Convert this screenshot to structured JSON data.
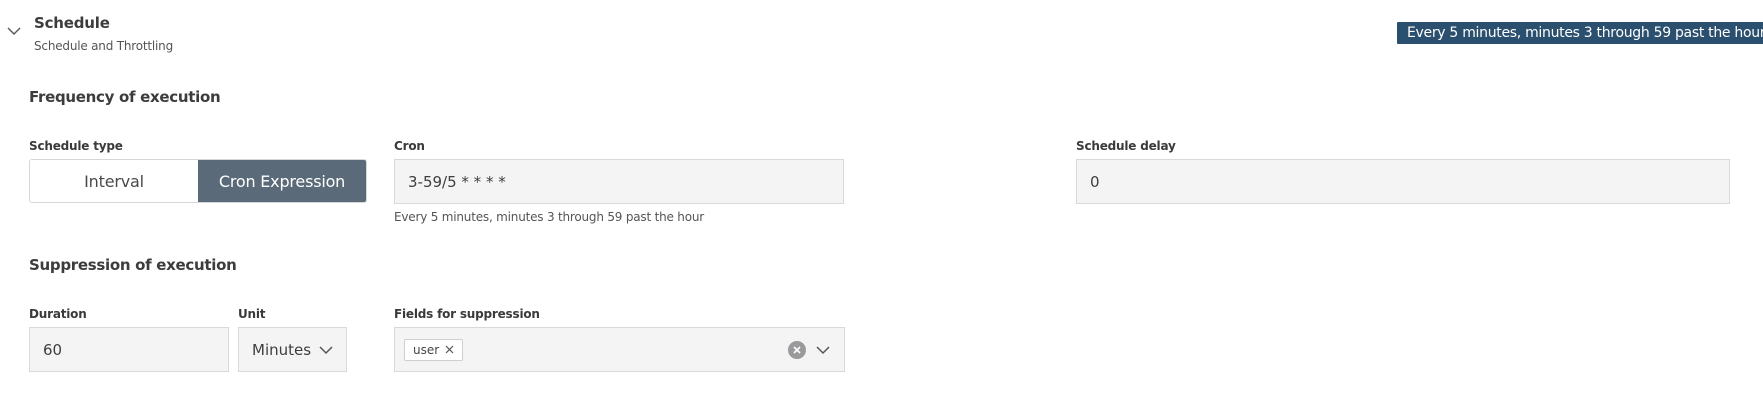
{
  "header": {
    "title": "Schedule",
    "subtitle": "Schedule and Throttling",
    "summary_badge": "Every 5 minutes, minutes 3 through 59 past the hour"
  },
  "frequency": {
    "section_title": "Frequency of execution",
    "schedule_type": {
      "label": "Schedule type",
      "options": [
        "Interval",
        "Cron Expression"
      ],
      "selected": "Cron Expression"
    },
    "cron": {
      "label": "Cron",
      "value": "3-59/5 * * * *",
      "hint": "Every 5 minutes, minutes 3 through 59 past the hour"
    },
    "schedule_delay": {
      "label": "Schedule delay",
      "value": "0"
    }
  },
  "suppression": {
    "section_title": "Suppression of execution",
    "duration": {
      "label": "Duration",
      "value": "60"
    },
    "unit": {
      "label": "Unit",
      "value": "Minutes"
    },
    "fields": {
      "label": "Fields for suppression",
      "tags": [
        "user"
      ]
    }
  },
  "icons": {
    "collapse": "chevron-down-icon",
    "select_arrow": "chevron-down-icon",
    "tag_remove": "close-icon",
    "clear": "clear-circle-icon"
  },
  "colors": {
    "badge_bg": "#2b4f6e",
    "segment_active_bg": "#5a6a78",
    "field_bg": "#f4f4f5"
  }
}
